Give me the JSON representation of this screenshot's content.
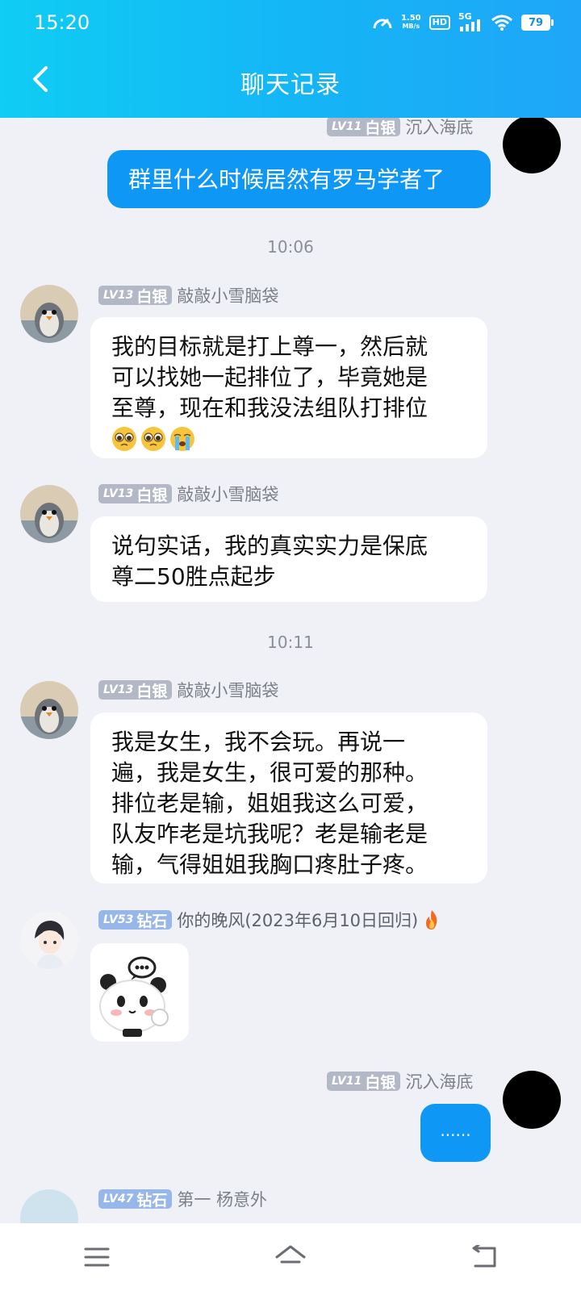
{
  "status_bar": {
    "time": "15:20",
    "net_speed_value": "1.50",
    "net_speed_unit": "MB/s",
    "hd": "HD",
    "network": "5G",
    "battery": "79"
  },
  "header": {
    "title": "聊天记录"
  },
  "messages": [
    {
      "side": "right",
      "level": "LV11",
      "rank": "白银",
      "name": "沉入海底",
      "text": "群里什么时候居然有罗马学者了"
    },
    {
      "type": "time",
      "text": "10:06"
    },
    {
      "side": "left",
      "level": "LV13",
      "rank": "白银",
      "name": "敲敲小雪脑袋",
      "lines": [
        "我的目标就是打上尊一，然后就",
        "可以找她一起排位了，毕竟她是",
        "至尊，现在和我没法组队打排位"
      ],
      "emojis": [
        "pleading-face-icon",
        "pleading-face-icon",
        "crying-face-icon"
      ]
    },
    {
      "side": "left",
      "level": "LV13",
      "rank": "白银",
      "name": "敲敲小雪脑袋",
      "lines": [
        "说句实话，我的真实实力是保底",
        "尊二50胜点起步"
      ]
    },
    {
      "type": "time",
      "text": "10:11"
    },
    {
      "side": "left",
      "level": "LV13",
      "rank": "白银",
      "name": "敲敲小雪脑袋",
      "lines": [
        "我是女生，我不会玩。再说一",
        "遍，我是女生，很可爱的那种。",
        "排位老是输，姐姐我这么可爱，",
        "队友咋老是坑我呢？老是输老是",
        "输，气得姐姐我胸口疼肚子疼。"
      ]
    },
    {
      "side": "left",
      "level": "LV53",
      "rank": "钻石",
      "name": "你的晚风(2023年6月10日回归)",
      "sticker": "panda-sticker",
      "flame": "fire-icon"
    },
    {
      "side": "right",
      "level": "LV11",
      "rank": "白银",
      "name": "沉入海底",
      "text": "......"
    },
    {
      "side": "left",
      "level": "LV47",
      "rank": "钻石",
      "name": "第一 杨意外",
      "partial": true
    }
  ],
  "navbar": {
    "items": [
      "menu-icon",
      "home-icon",
      "back-icon"
    ]
  },
  "colors": {
    "header_start": "#0fcdf4",
    "header_end": "#1fa6f8",
    "bubble_self": "#0e97f4",
    "bg": "#f0f1f6"
  }
}
